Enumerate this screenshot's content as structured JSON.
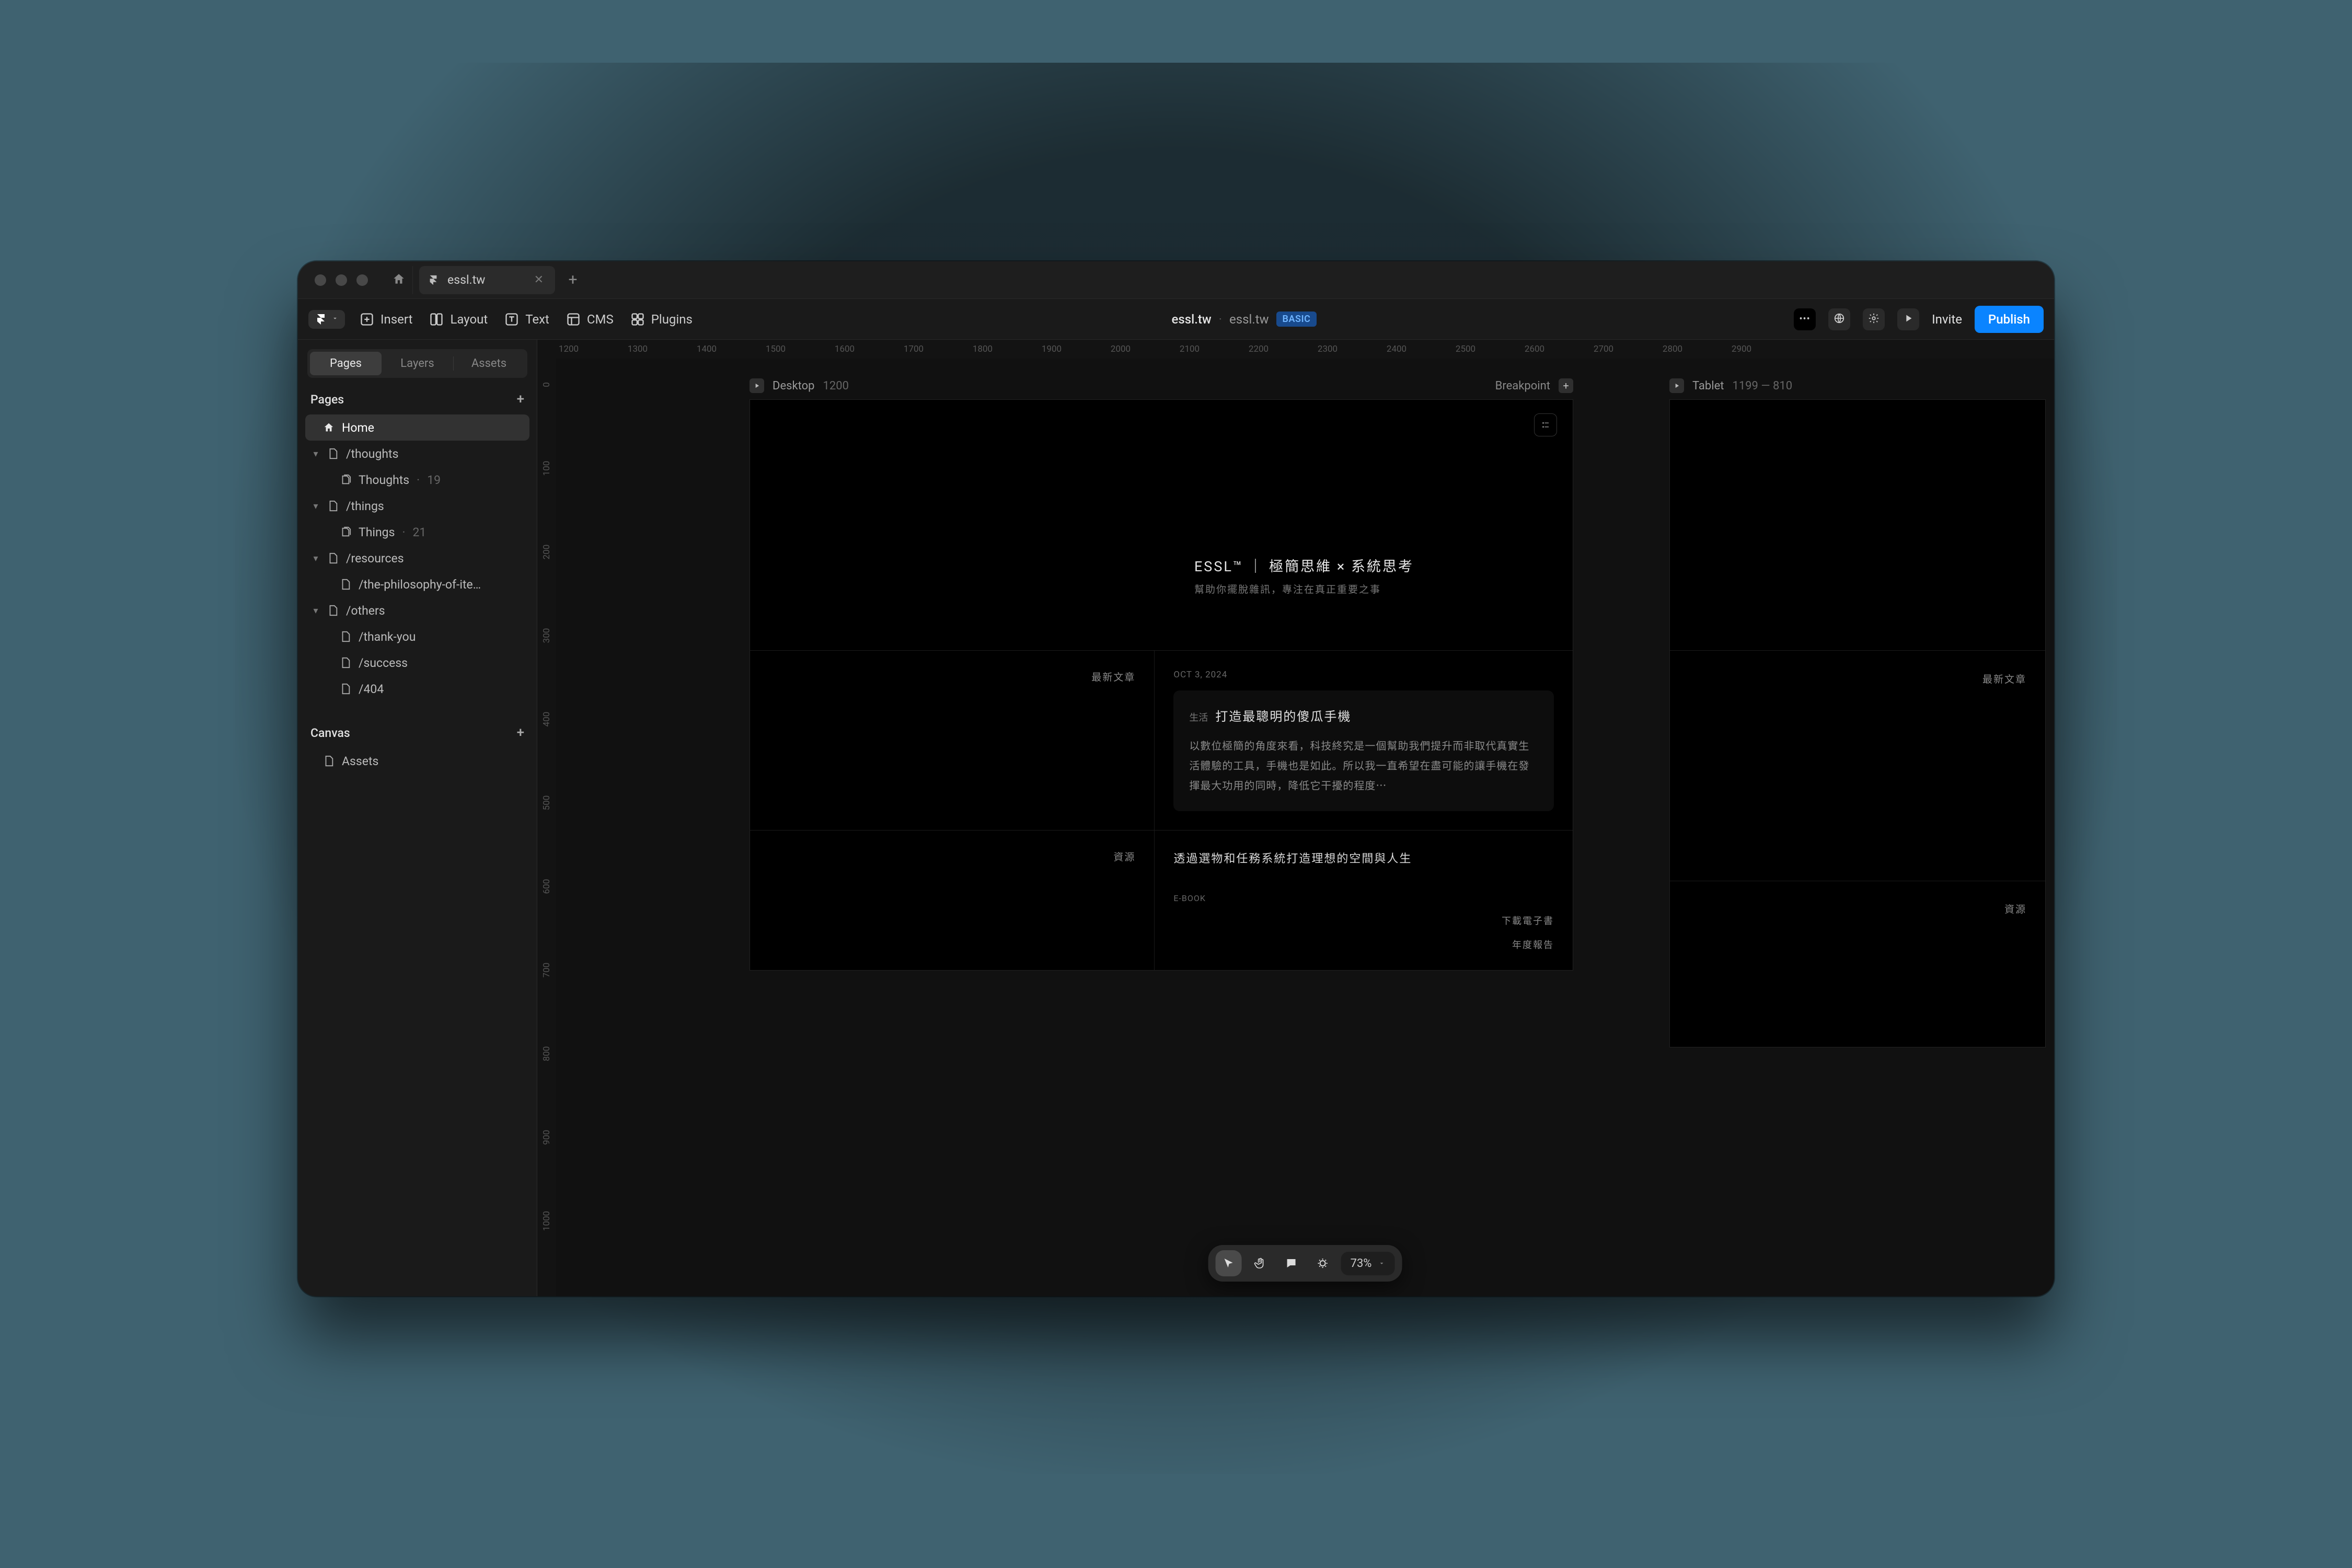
{
  "tabbar": {
    "project_tab": "essl.tw"
  },
  "toolbar": {
    "insert": "Insert",
    "layout": "Layout",
    "text": "Text",
    "cms": "CMS",
    "plugins": "Plugins",
    "breadcrumb_project": "essl.tw",
    "breadcrumb_site": "essl.tw",
    "plan_badge": "BASIC",
    "dots": "•••",
    "invite": "Invite",
    "publish": "Publish"
  },
  "sidebar": {
    "tabs": {
      "pages": "Pages",
      "layers": "Layers",
      "assets": "Assets"
    },
    "pages_heading": "Pages",
    "canvas_heading": "Canvas",
    "tree": {
      "home": "Home",
      "thoughts_folder": "/thoughts",
      "thoughts_index": "Thoughts",
      "thoughts_count": "19",
      "things_folder": "/things",
      "things_index": "Things",
      "things_count": "21",
      "resources_folder": "/resources",
      "resources_child": "/the-philosophy-of-ite…",
      "others_folder": "/others",
      "others_thankyou": "/thank-you",
      "others_success": "/success",
      "others_404": "/404"
    },
    "canvas_assets": "Assets"
  },
  "ruler_h": [
    "1200",
    "1300",
    "1400",
    "1500",
    "1600",
    "1700",
    "1800",
    "1900",
    "2000",
    "2100",
    "2200",
    "2300",
    "2400",
    "2500",
    "2600",
    "2700",
    "2800",
    "2900"
  ],
  "ruler_v": [
    "0",
    "100",
    "200",
    "300",
    "400",
    "500",
    "600",
    "700",
    "800",
    "900",
    "1000"
  ],
  "frames": {
    "desktop": {
      "label": "Desktop",
      "dim": "1200",
      "breakpoint": "Breakpoint"
    },
    "tablet": {
      "label": "Tablet",
      "dim": "1199 — 810"
    }
  },
  "site": {
    "hero_title": "ESSL™ ｜ 極簡思維 × 系統思考",
    "hero_sub": "幫助你擺脫雜訊，專注在真正重要之事",
    "latest_label": "最新文章",
    "article_date": "OCT 3, 2024",
    "article_tag": "生活",
    "article_title": "打造最聰明的傻瓜手機",
    "article_body": "以數位極簡的角度來看，科技終究是一個幫助我們提升而非取代真實生活體驗的工具，手機也是如此。所以我一直希望在盡可能的讓手機在發揮最大功用的同時，降低它干擾的程度⋯",
    "resources_label": "資源",
    "resources_title": "透過選物和任務系統打造理想的空間與人生",
    "ebook_label": "E-BOOK",
    "download_ebook": "下載電子書",
    "annual_report": "年度報告"
  },
  "dock": {
    "zoom": "73%"
  }
}
